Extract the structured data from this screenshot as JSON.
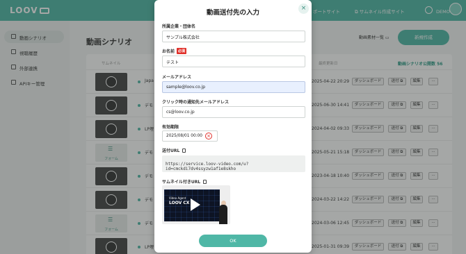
{
  "header": {
    "logo": "LOOV",
    "links": [
      "ポートサイト",
      "サムネイル作成サイト"
    ],
    "user": "DEMO 様"
  },
  "sidebar": {
    "items": [
      {
        "label": "動画シナリオ",
        "icon": "video-icon",
        "active": true
      },
      {
        "label": "視聴履歴",
        "icon": "user-history-icon",
        "active": false
      },
      {
        "label": "外部連携",
        "icon": "external-link-icon",
        "active": false
      },
      {
        "label": "APIキー管理",
        "icon": "key-icon",
        "active": false
      }
    ]
  },
  "main": {
    "title": "動画シナリオ",
    "assets_link": "動画素材一覧",
    "new_button": "新規作成",
    "columns": [
      "サムネイル",
      "最終更新日"
    ],
    "public_count": "動画シナリオ公開数 56",
    "rows": [
      {
        "name": "Japa",
        "thumb": "video",
        "date": "2025-04-22 20:29"
      },
      {
        "name": "デモ",
        "thumb": "video",
        "date": "2025-06-30 14:41"
      },
      {
        "name": "LP埋",
        "thumb": "video",
        "date": "2024-04-02 09:33"
      },
      {
        "name": "デモ",
        "thumb": "form",
        "date": "2025-05-21 15:18"
      },
      {
        "name": "デモ",
        "thumb": "video",
        "date": "2023-04-18 10:40"
      },
      {
        "name": "デモ",
        "thumb": "video",
        "date": "2024-03-22 14:22"
      },
      {
        "name": "デモ",
        "thumb": "form",
        "date": "2024-03-06 12:45"
      },
      {
        "name": "LP埋",
        "thumb": "video",
        "date": "2025-01-31 09:39"
      }
    ],
    "row_buttons": {
      "dashboard": "ダッシュボード",
      "send": "送付",
      "edit": "編集",
      "more": "···"
    },
    "form_thumb_label": "フォーム"
  },
  "modal": {
    "title": "動画送付先の入力",
    "close": "×",
    "company_label": "所属企業・団体名",
    "company_value": "サンプル株式会社",
    "name_label": "お名前",
    "required_badge": "必須",
    "name_value": "テスト",
    "email_label": "メールアドレス",
    "email_value": "sample@loov.co.jp",
    "notify_label": "クリック時の通知先メールアドレス",
    "notify_value": "cs@loov.co.jp",
    "expiry_label": "有効期限",
    "expiry_value": "2025/08/01 00:00",
    "url_label": "送付URL",
    "url_value": "https://service.loov-video.com/u?id=cmckdi7dv4ssyzw1af1e8skho",
    "thumb_url_label": "サムネイル付きURL",
    "preview_heading": "Video Agent",
    "preview_logo": "LOOV CX",
    "ok_button": "OK"
  }
}
